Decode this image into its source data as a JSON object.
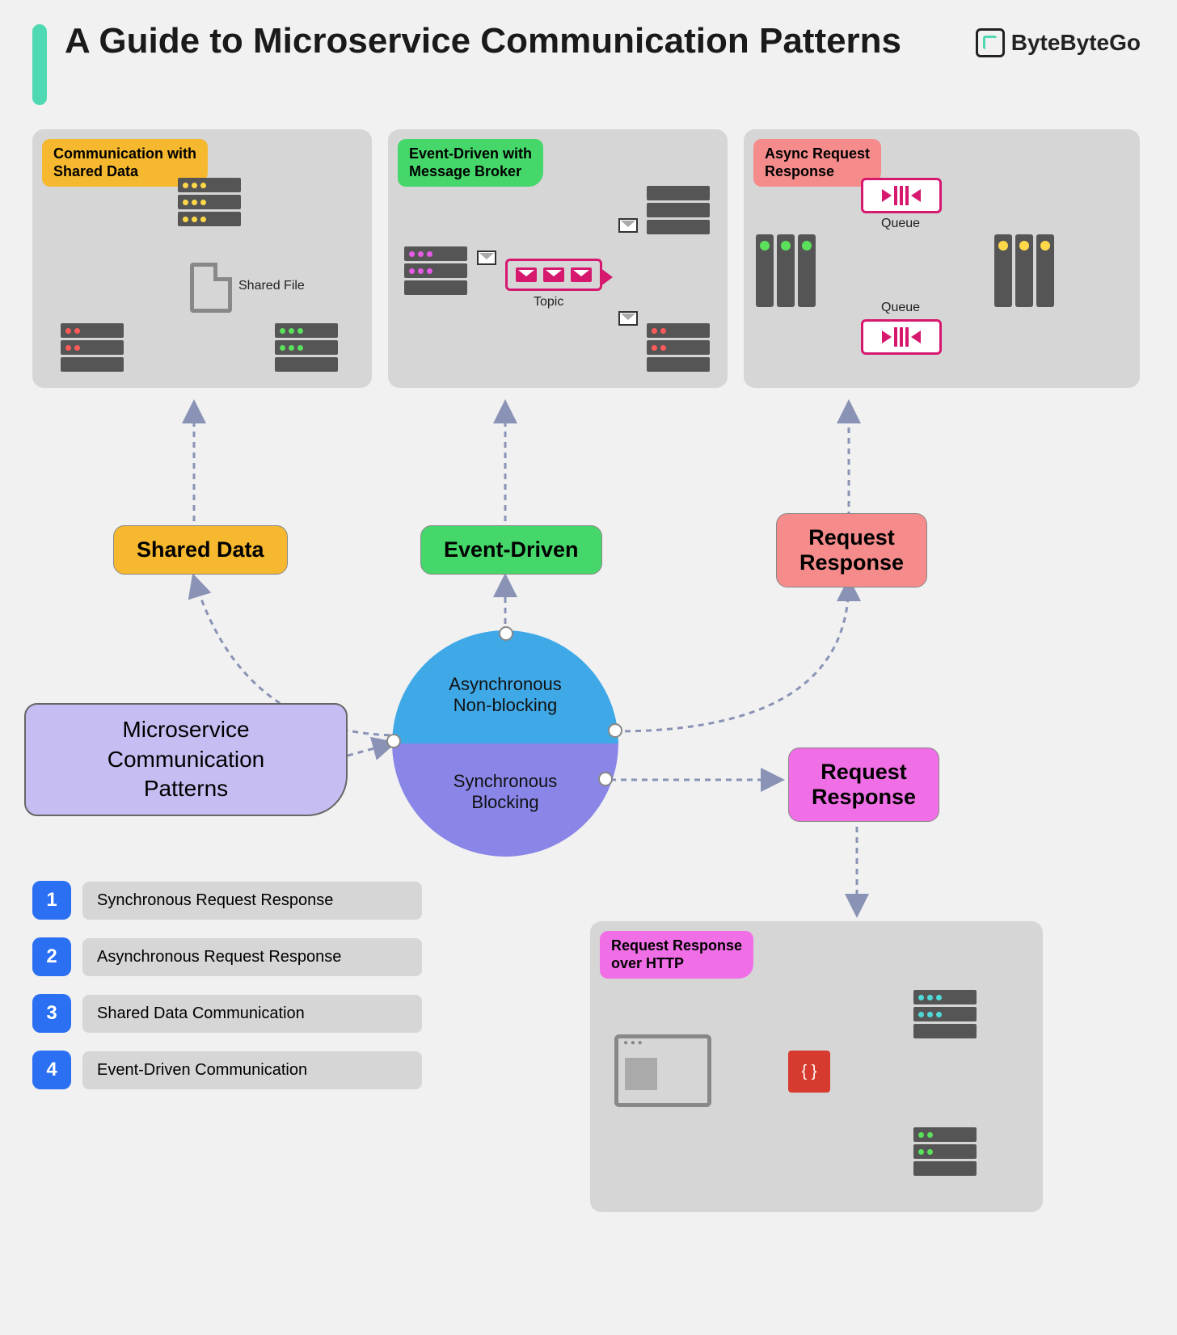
{
  "title": "A Guide to Microservice Communication Patterns",
  "brand": "ByteByteGo",
  "panels": {
    "shared": {
      "label": "Communication with\nShared Data",
      "center_label": "Shared File"
    },
    "event": {
      "label": "Event-Driven with\nMessage Broker",
      "topic_label": "Topic"
    },
    "async": {
      "label": "Async Request\nResponse",
      "queue_label": "Queue"
    },
    "http": {
      "label": "Request Response\nover HTTP"
    }
  },
  "pills": {
    "shared": "Shared Data",
    "event": "Event-Driven",
    "async_rr": "Request\nResponse",
    "sync_rr": "Request\nResponse"
  },
  "circle": {
    "top": "Asynchronous\nNon-blocking",
    "bottom": "Synchronous\nBlocking"
  },
  "root": "Microservice\nCommunication\nPatterns",
  "list": [
    "Synchronous Request Response",
    "Asynchronous Request Response",
    "Shared Data Communication",
    "Event-Driven Communication"
  ]
}
